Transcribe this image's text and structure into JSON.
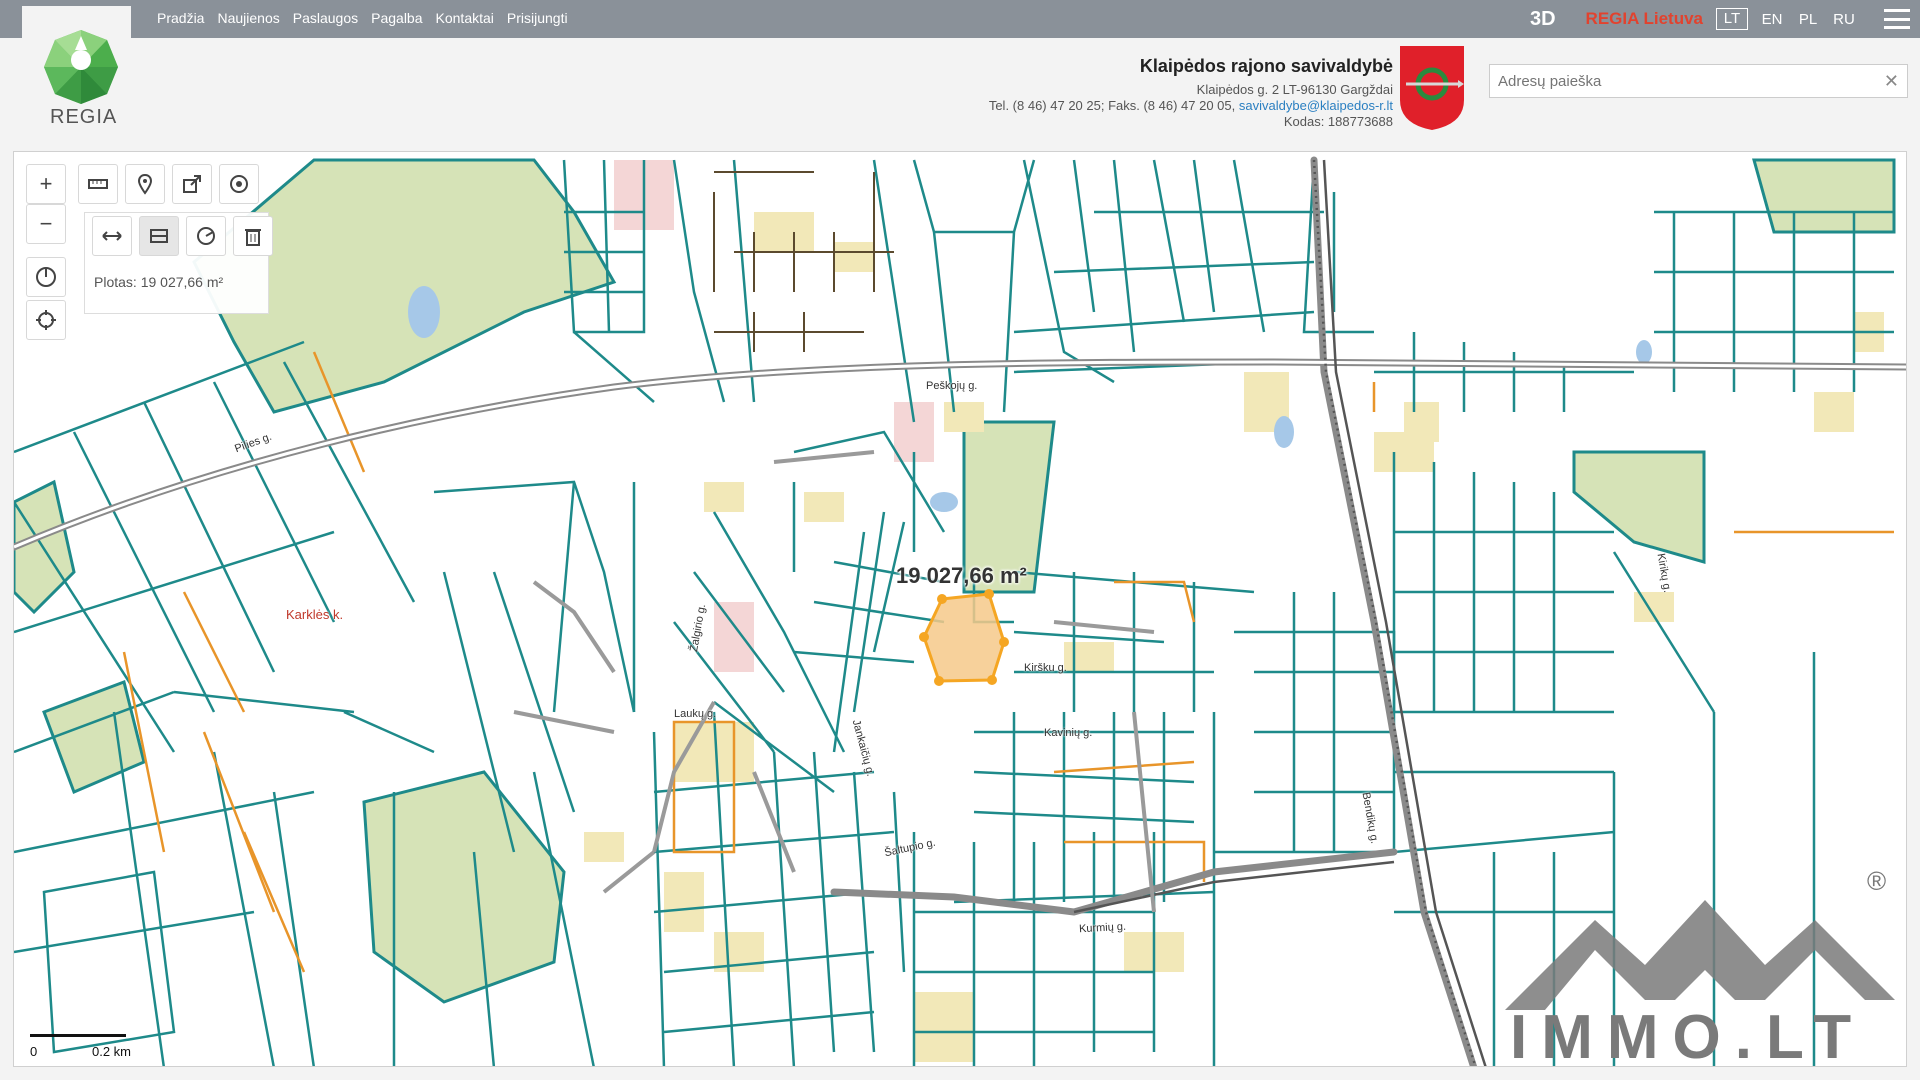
{
  "nav": [
    "Pradžia",
    "Naujienos",
    "Paslaugos",
    "Pagalba",
    "Kontaktai",
    "Prisijungti"
  ],
  "top_right": {
    "btn_3d": "3D",
    "regia_lietuva": "REGIA Lietuva",
    "languages": [
      "LT",
      "EN",
      "PL",
      "RU"
    ],
    "active_language": "LT"
  },
  "logo": {
    "text": "REGIA"
  },
  "municipality": {
    "name": "Klaipėdos rajono savivaldybė",
    "address": "Klaipėdos g. 2 LT-96130 Gargždai",
    "phone": "Tel. (8 46) 47 20 25; Faks. (8 46) 47 20 05,",
    "email": "savivaldybe@klaipedos-r.lt",
    "code": "Kodas: 188773688"
  },
  "search": {
    "placeholder": "Adresų paieška"
  },
  "tools": {
    "zoom_in": "+",
    "zoom_out": "−",
    "area_label": "Plotas: 19 027,66 m²"
  },
  "map": {
    "measurement": "19 027,66 m²",
    "places": {
      "karkles": "Karklės k.",
      "peskoju": "Peškojų g.",
      "zalgirio": "Žalgirio g.",
      "lauku": "Laukų g.",
      "jankaiciu": "Jankaičių g.",
      "saltupio": "Šaltupio g.",
      "kirsku": "Kiršku g.",
      "kurmiu": "Kurmių g.",
      "bendiku": "Bendikų g.",
      "kiriku": "Kirikų g.",
      "kaviniu": "Kavinių g.",
      "pilies": "Pilies g."
    },
    "scale": {
      "zero": "0",
      "distance": "0.2 km"
    },
    "colors": {
      "parcel": "#1e8a8a",
      "road": "#7a7a7a",
      "green": "#d4e2b4",
      "building": "#f2e8b8",
      "selection": "#f5a623"
    }
  },
  "watermark": {
    "text": "IMMO.LT",
    "reg": "®"
  }
}
